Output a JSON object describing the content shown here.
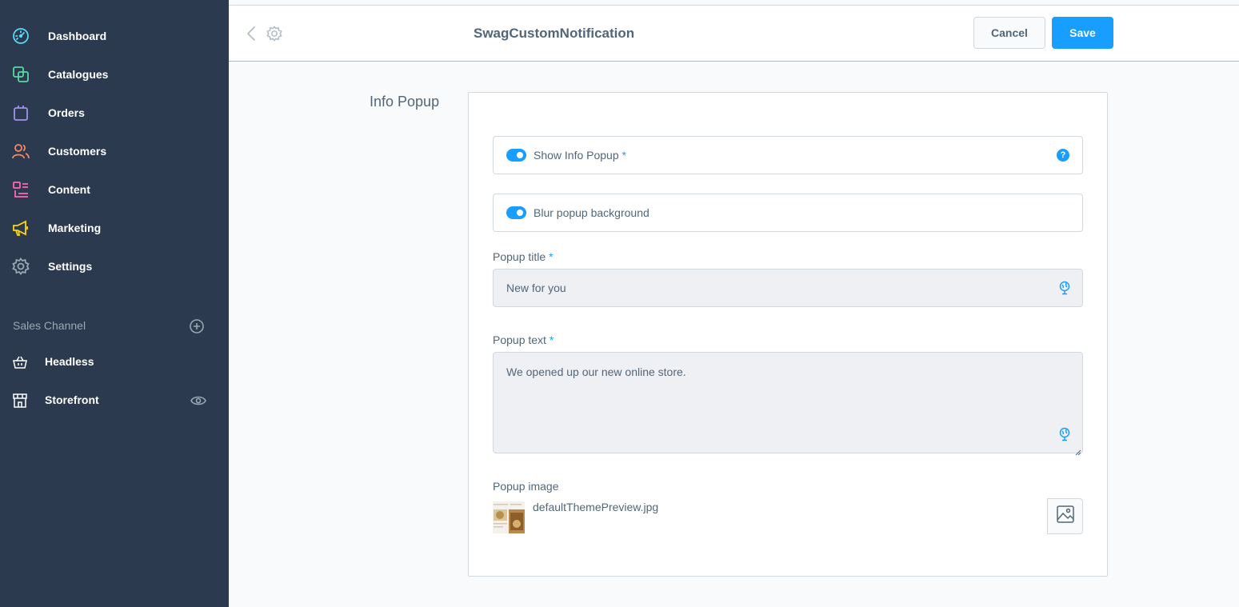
{
  "sidebar": {
    "nav": [
      {
        "label": "Dashboard",
        "icon": "dashboard-gauge-icon",
        "color": "#57d9f7"
      },
      {
        "label": "Catalogues",
        "icon": "catalogues-icon",
        "color": "#57d9a3"
      },
      {
        "label": "Orders",
        "icon": "shopping-bag-icon",
        "color": "#a092f0"
      },
      {
        "label": "Customers",
        "icon": "users-icon",
        "color": "#f88962"
      },
      {
        "label": "Content",
        "icon": "content-list-icon",
        "color": "#ff68b4"
      },
      {
        "label": "Marketing",
        "icon": "megaphone-icon",
        "color": "#ffd700"
      },
      {
        "label": "Settings",
        "icon": "gear-icon",
        "color": "#9aa8b5"
      }
    ],
    "sales_channel": {
      "heading": "Sales Channel",
      "items": [
        {
          "label": "Headless",
          "icon": "basket-icon"
        },
        {
          "label": "Storefront",
          "icon": "storefront-icon"
        }
      ]
    }
  },
  "header": {
    "title": "SwagCustomNotification",
    "cancel_label": "Cancel",
    "save_label": "Save"
  },
  "card": {
    "title": "Info Popup",
    "show_popup": {
      "label": "Show Info Popup",
      "required": "*",
      "enabled": true,
      "help": "?"
    },
    "blur_background": {
      "label": "Blur popup background",
      "enabled": true
    },
    "popup_title": {
      "label": "Popup title",
      "required": "*",
      "value": "New for you"
    },
    "popup_text": {
      "label": "Popup text",
      "required": "*",
      "value": "We opened up our new online store."
    },
    "popup_image": {
      "label": "Popup image",
      "file_name": "defaultThemePreview.jpg"
    }
  },
  "colors": {
    "sidebar_bg": "#2b3a4e",
    "accent": "#189eff",
    "text": "#52667a"
  }
}
